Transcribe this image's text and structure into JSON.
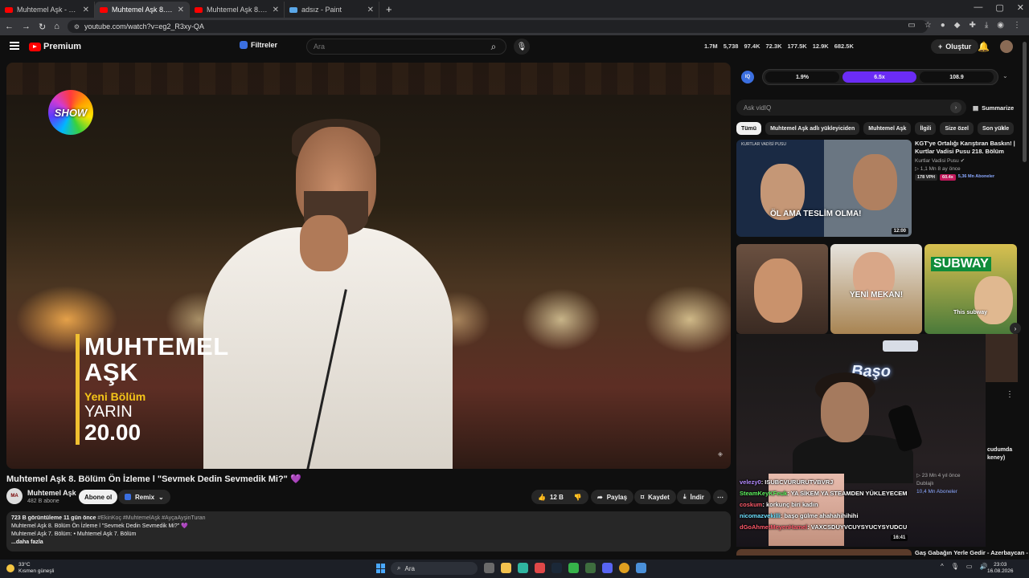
{
  "browser": {
    "tabs": [
      {
        "label": "Muhtemel Aşk - YouTube",
        "active": false
      },
      {
        "label": "Muhtemel Aşk 8. Bölüm Ön",
        "active": true
      },
      {
        "label": "Muhtemel Aşk 8. Bölüm 2. Ön",
        "active": false
      },
      {
        "label": "adsız - Paint",
        "active": false
      }
    ],
    "url": "youtube.com/watch?v=eg2_R3xy-QA"
  },
  "header": {
    "logo_text": "Premium",
    "filters_label": "Filtreler",
    "search_placeholder": "Ara",
    "stats": [
      "1.7M",
      "5,738",
      "97.4K",
      "72.3K",
      "177.5K",
      "12.9K",
      "682.5K"
    ],
    "create_label": "Oluştur"
  },
  "video": {
    "overlay": {
      "channel_logo": "SHOW",
      "line1": "MUHTEMEL",
      "line2": "AŞK",
      "line3": "Yeni Bölüm",
      "line4": "YARIN",
      "line5": "20.00"
    },
    "title": "Muhtemel Aşk 8. Bölüm Ön İzleme l \"Sevmek Dedin Sevmedik Mi?\" 💜",
    "channel_name": "Muhtemel Aşk",
    "channel_subs": "482 B abone",
    "subscribe_label": "Abone ol",
    "remix_label": "Remix",
    "like_count": "12 B",
    "share_label": "Paylaş",
    "save_label": "Kaydet",
    "download_label": "İndir"
  },
  "description": {
    "meta": "723 B görüntüleme  11 gün önce",
    "tags": "#EkinKoç #MuhtemelAşk #AyçaAyşinTuran",
    "line2": "Muhtemel Aşk 8. Bölüm Ön İzleme l \"Sevmek Dedin Sevmedik Mi?\" 💜",
    "line3_prefix": "Muhtemel Aşk 7. Bölüm:",
    "line3_link": "• Muhtemel Aşk 7. Bölüm",
    "more_label": "...daha fazla"
  },
  "sidebar": {
    "iq": {
      "logo": "IQ",
      "segments": [
        "1.9%",
        "6.5x",
        "108.9"
      ]
    },
    "ask_placeholder": "Ask vidIQ",
    "summarize_label": "Summarize",
    "chips": [
      "Tümü",
      "Muhtemel Aşk adlı yükleyiciden",
      "Muhtemel Aşk",
      "İlgili",
      "Size özel",
      "Son yükle"
    ],
    "video1": {
      "thumb_top": "KURTLAR VADİSİ PUSU",
      "thumb_text": "ÖL AMA TESLİM OLMA!",
      "duration": "12:00",
      "title": "KGT'ye Ortalığı Karıştıran Baskın! | Kurtlar Vadisi Pusu 218. Bölüm",
      "channel": "Kurtlar Vadisi Pusu",
      "stats": "▷ 1,1 Mn  8 ay önce",
      "vph": "178 VPH",
      "ratio": "60.4x",
      "subs": "5,36 Mn Aboneler"
    },
    "shorts": [
      {
        "caption": ""
      },
      {
        "caption": "YENİ MEKAN!"
      },
      {
        "sign": "SUBWAY",
        "caption": "This subway"
      }
    ],
    "stream": {
      "neon": "Başo",
      "duration": "16:41",
      "chat": [
        {
          "name": "velezy0",
          "msg": ": ISUBCVURURUTVBVRJ",
          "color": "purple"
        },
        {
          "name": "SteamKeyKFeuk",
          "msg": ": YA SİKEM YA STEAMDEN YÜKLEYECEM",
          "color": "green"
        },
        {
          "name": "coskum",
          "msg": ": korkunç biri kadın",
          "color": "red"
        },
        {
          "name": "nicomazvekilli",
          "msg": ": başo gülme ahahahihihihi",
          "color": "cyan"
        },
        {
          "name": "dGoAhmetMeyenHamel",
          "msg": ": VAXCSDUYVCUYSYUCYSYUDCU",
          "color": "red"
        }
      ]
    },
    "video2": {
      "title_frag": "cudumda\nkeney)",
      "stats": "▷ 23 Mn  4 yıl önce",
      "badge": "Dublajlı",
      "subs": "10,4 Mn Aboneler"
    },
    "video3_title": "Gaş Gabağın Yerle Gedir - Azerbaycan -"
  },
  "taskbar": {
    "temp": "33°C",
    "weather": "Kısmen güneşli",
    "search": "Ara",
    "time": "23:03",
    "date": "16.08.2026"
  }
}
